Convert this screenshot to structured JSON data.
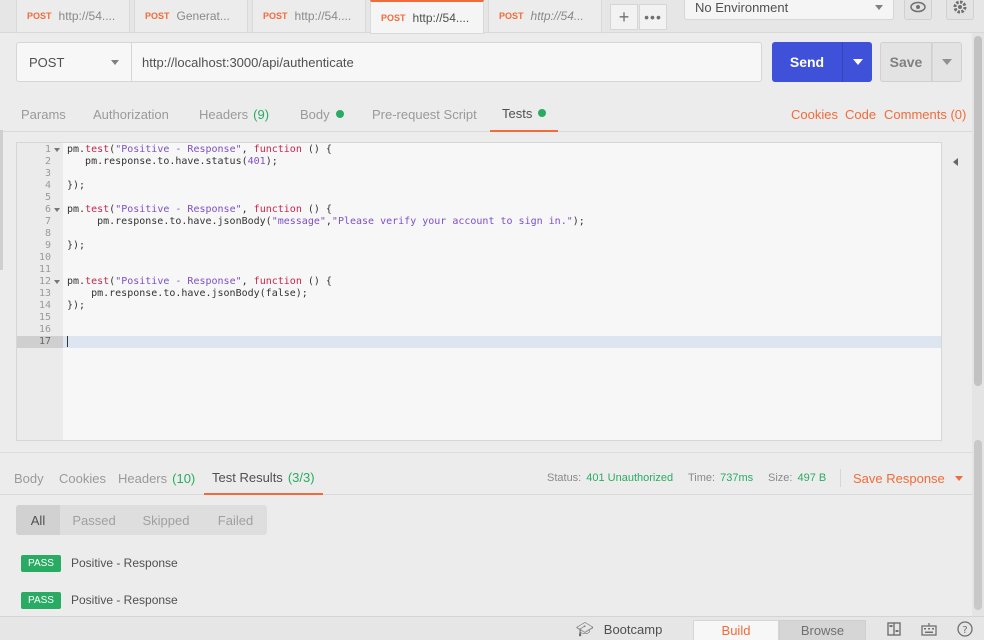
{
  "tabs": [
    {
      "method": "POST",
      "title": "http://54....",
      "unsaved": true,
      "italic": false
    },
    {
      "method": "POST",
      "title": "Generat...",
      "unsaved": false,
      "italic": false
    },
    {
      "method": "POST",
      "title": "http://54....",
      "unsaved": true,
      "italic": false
    },
    {
      "method": "POST",
      "title": "http://54....",
      "unsaved": true,
      "italic": false,
      "active": true
    },
    {
      "method": "POST",
      "title": "http://54...",
      "unsaved": false,
      "italic": true
    }
  ],
  "tab_actions": {
    "add_icon": "plus-icon",
    "more_icon": "ellipsis-icon"
  },
  "environment": {
    "selected": "No Environment"
  },
  "header_icons": [
    "eye-icon",
    "gear-icon"
  ],
  "request": {
    "method": "POST",
    "url": "http://localhost:3000/api/authenticate",
    "send_label": "Send",
    "save_label": "Save"
  },
  "request_tabs": {
    "params": "Params",
    "authorization": "Authorization",
    "headers": "Headers",
    "headers_count": "(9)",
    "body": "Body",
    "pre_request": "Pre-request Script",
    "tests": "Tests",
    "cookies": "Cookies",
    "code": "Code",
    "comments": "Comments (0)"
  },
  "editor": {
    "lines": [
      {
        "n": "1",
        "fold": true,
        "html": "pm.<span class='kw'>test</span>(<span class='str'>\"Positive - Response\"</span>, <span class='kw'>function</span> () {"
      },
      {
        "n": "2",
        "fold": false,
        "html": "   pm.response.to.have.status(<span class='num'>401</span>);"
      },
      {
        "n": "3",
        "fold": false,
        "html": ""
      },
      {
        "n": "4",
        "fold": false,
        "html": "});"
      },
      {
        "n": "5",
        "fold": false,
        "html": ""
      },
      {
        "n": "6",
        "fold": true,
        "html": "pm.<span class='kw'>test</span>(<span class='str'>\"Positive - Response\"</span>, <span class='kw'>function</span> () {"
      },
      {
        "n": "7",
        "fold": false,
        "html": "     pm.response.to.have.jsonBody(<span class='str'>\"message\"</span>,<span class='str'>\"Please verify your account to sign in.\"</span>);"
      },
      {
        "n": "8",
        "fold": false,
        "html": ""
      },
      {
        "n": "9",
        "fold": false,
        "html": "});"
      },
      {
        "n": "10",
        "fold": false,
        "html": ""
      },
      {
        "n": "11",
        "fold": false,
        "html": ""
      },
      {
        "n": "12",
        "fold": true,
        "html": "pm.<span class='kw'>test</span>(<span class='str'>\"Positive - Response\"</span>, <span class='kw'>function</span> () {"
      },
      {
        "n": "13",
        "fold": false,
        "html": "    pm.response.to.have.jsonBody(false);"
      },
      {
        "n": "14",
        "fold": false,
        "html": "});"
      },
      {
        "n": "15",
        "fold": false,
        "html": ""
      },
      {
        "n": "16",
        "fold": false,
        "html": ""
      },
      {
        "n": "17",
        "fold": false,
        "html": "",
        "current": true
      }
    ]
  },
  "response": {
    "tabs": {
      "body": "Body",
      "cookies": "Cookies",
      "headers": "Headers",
      "headers_count": "(10)",
      "test_results": "Test Results",
      "test_results_count": "(3/3)"
    },
    "status_label": "Status:",
    "status_value": "401 Unauthorized",
    "time_label": "Time:",
    "time_value": "737ms",
    "size_label": "Size:",
    "size_value": "497 B",
    "save_response": "Save Response"
  },
  "filters": [
    "All",
    "Passed",
    "Skipped",
    "Failed"
  ],
  "results": [
    {
      "badge": "PASS",
      "name": "Positive - Response"
    },
    {
      "badge": "PASS",
      "name": "Positive - Response"
    }
  ],
  "statusbar": {
    "bootcamp": "Bootcamp",
    "build": "Build",
    "browse": "Browse",
    "icons": [
      "two-pane-icon",
      "keyboard-icon",
      "help-icon"
    ]
  },
  "colors": {
    "accent": "#f26b3a",
    "send": "#3f51d8",
    "success": "#2aab64"
  }
}
